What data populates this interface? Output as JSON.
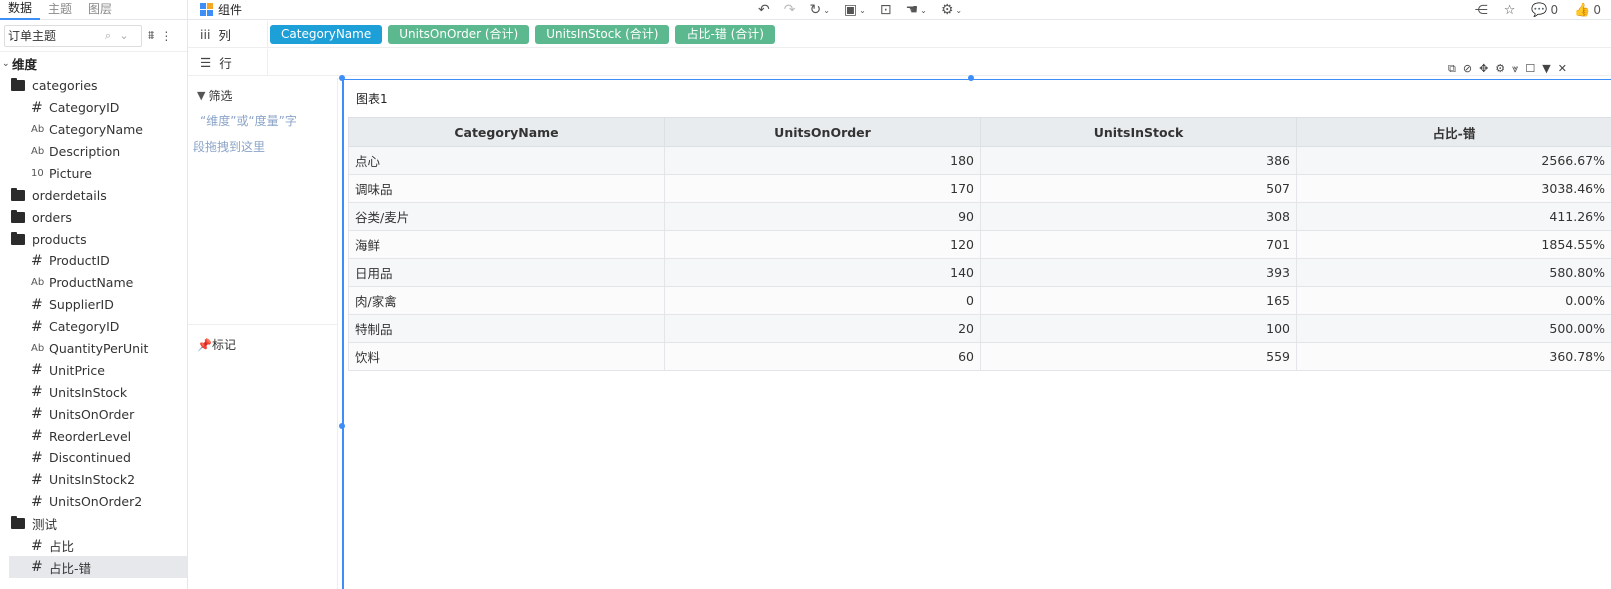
{
  "left_tabs": [
    "数据",
    "主题",
    "图层"
  ],
  "search": {
    "value": "订单主题"
  },
  "tree": {
    "section_label": "维度",
    "categories": {
      "label": "categories",
      "fields": [
        {
          "type": "#",
          "name": "CategoryID"
        },
        {
          "type": "Ab",
          "name": "CategoryName"
        },
        {
          "type": "Ab",
          "name": "Description"
        },
        {
          "type": "10",
          "name": "Picture"
        }
      ]
    },
    "orderdetails": {
      "label": "orderdetails"
    },
    "orders": {
      "label": "orders"
    },
    "products": {
      "label": "products",
      "fields": [
        {
          "type": "#",
          "name": "ProductID"
        },
        {
          "type": "Ab",
          "name": "ProductName"
        },
        {
          "type": "#",
          "name": "SupplierID"
        },
        {
          "type": "#",
          "name": "CategoryID"
        },
        {
          "type": "Ab",
          "name": "QuantityPerUnit"
        },
        {
          "type": "#",
          "name": "UnitPrice"
        },
        {
          "type": "#",
          "name": "UnitsInStock"
        },
        {
          "type": "#",
          "name": "UnitsOnOrder"
        },
        {
          "type": "#",
          "name": "ReorderLevel"
        },
        {
          "type": "#",
          "name": "Discontinued"
        },
        {
          "type": "#",
          "name": "UnitsInStock2"
        },
        {
          "type": "#",
          "name": "UnitsOnOrder2"
        }
      ]
    },
    "test": {
      "label": "测试",
      "fields": [
        {
          "type": "#",
          "name": "占比"
        },
        {
          "type": "#",
          "name": "占比-错"
        }
      ]
    }
  },
  "toolbar": {
    "component_label": "组件",
    "comments_count": "0",
    "likes_count": "0"
  },
  "shelves": {
    "columns_label": "列",
    "rows_label": "行",
    "column_pills": [
      {
        "label": "CategoryName",
        "kind": "dim"
      },
      {
        "label": "UnitsOnOrder (合计)",
        "kind": "meas"
      },
      {
        "label": "UnitsInStock (合计)",
        "kind": "meas"
      },
      {
        "label": "占比-错 (合计)",
        "kind": "meas"
      }
    ]
  },
  "filter_panel": {
    "title": "筛选",
    "hint_line1": "“维度”或“度量”字",
    "hint_line2": "段拖拽到这里",
    "mark_title": "标记"
  },
  "widget": {
    "title": "图表1",
    "table": {
      "headers": [
        "CategoryName",
        "UnitsOnOrder",
        "UnitsInStock",
        "占比-错"
      ],
      "rows": [
        [
          "点心",
          "180",
          "386",
          "2566.67%"
        ],
        [
          "调味品",
          "170",
          "507",
          "3038.46%"
        ],
        [
          "谷类/麦片",
          "90",
          "308",
          "411.26%"
        ],
        [
          "海鲜",
          "120",
          "701",
          "1854.55%"
        ],
        [
          "日用品",
          "140",
          "393",
          "580.80%"
        ],
        [
          "肉/家禽",
          "0",
          "165",
          "0.00%"
        ],
        [
          "特制品",
          "20",
          "100",
          "500.00%"
        ],
        [
          "饮料",
          "60",
          "559",
          "360.78%"
        ]
      ]
    }
  },
  "colors": {
    "dimension_pill": "#1d9fd8",
    "measure_pill": "#5cb88e",
    "selection": "#3d8ef7"
  }
}
